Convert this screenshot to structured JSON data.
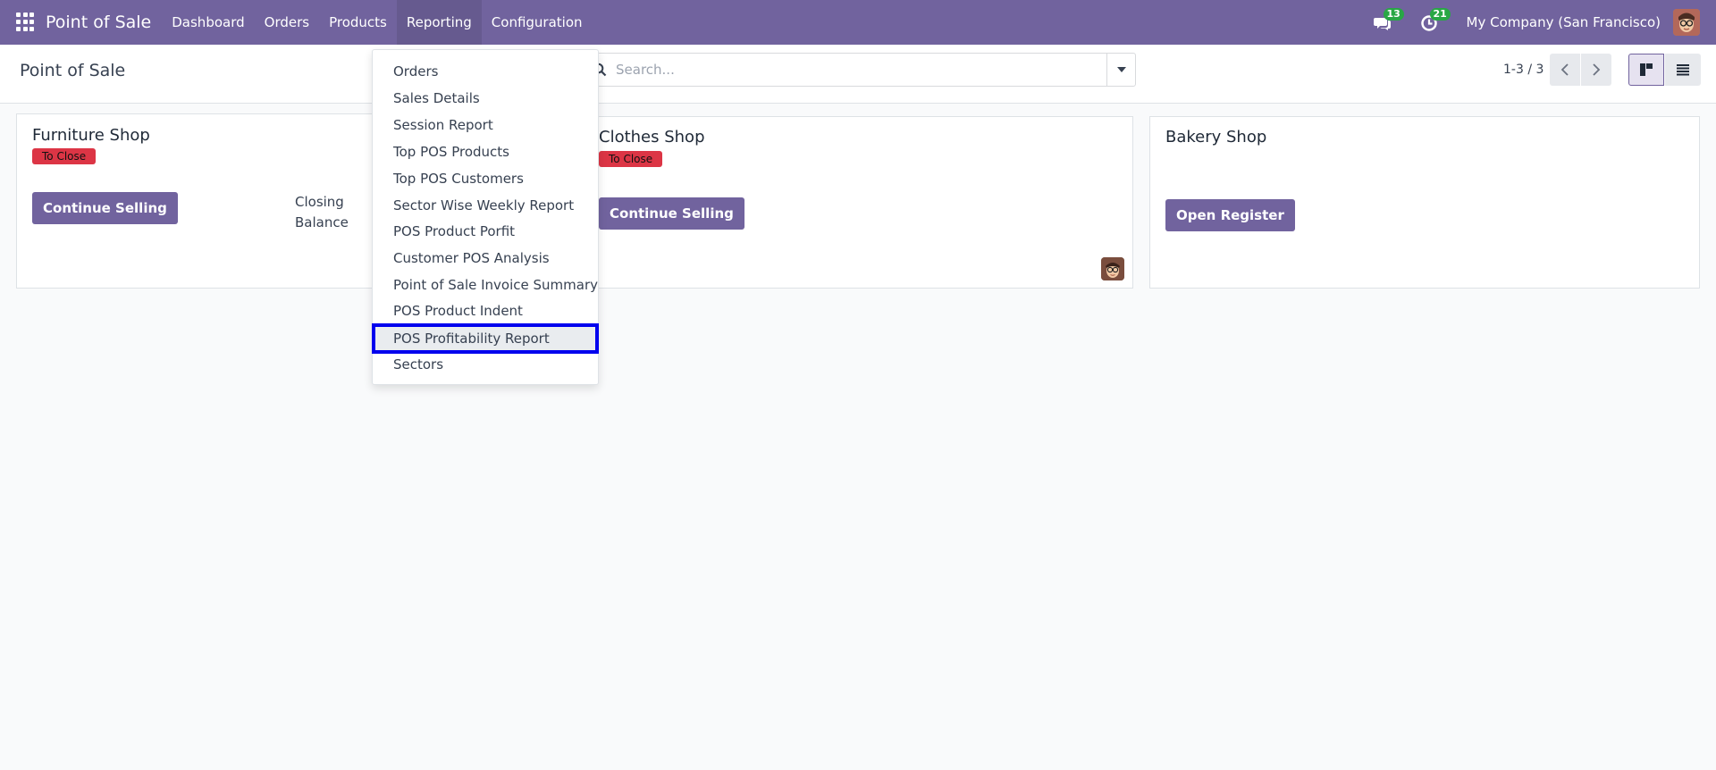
{
  "navbar": {
    "app_name": "Point of Sale",
    "menu": [
      "Dashboard",
      "Orders",
      "Products",
      "Reporting",
      "Configuration"
    ],
    "active_menu": "Reporting",
    "messages_count": "13",
    "activities_count": "21",
    "company": "My Company (San Francisco)"
  },
  "control_panel": {
    "title": "Point of Sale",
    "search_placeholder": "Search...",
    "pager": "1-3 / 3"
  },
  "reporting_menu": {
    "items": [
      "Orders",
      "Sales Details",
      "Session Report",
      "Top POS Products",
      "Top POS Customers",
      "Sector Wise Weekly Report",
      "POS Product Porfit",
      "Customer POS Analysis",
      "Point of Sale Invoice Summary",
      "POS Product Indent",
      "POS Profitability Report",
      "Sectors"
    ],
    "highlighted": "POS Profitability Report"
  },
  "cards": [
    {
      "name": "Furniture Shop",
      "status": "To Close",
      "button": "Continue Selling",
      "closing_label_1": "Closing",
      "closing_label_2": "Balance"
    },
    {
      "name": "Clothes Shop",
      "status": "To Close",
      "button": "Continue Selling"
    },
    {
      "name": "Bakery Shop",
      "button": "Open Register"
    }
  ],
  "colors": {
    "brand": "#71639e",
    "status_to_close": "#dc3545",
    "menu_highlight_border": "#0000ee"
  }
}
